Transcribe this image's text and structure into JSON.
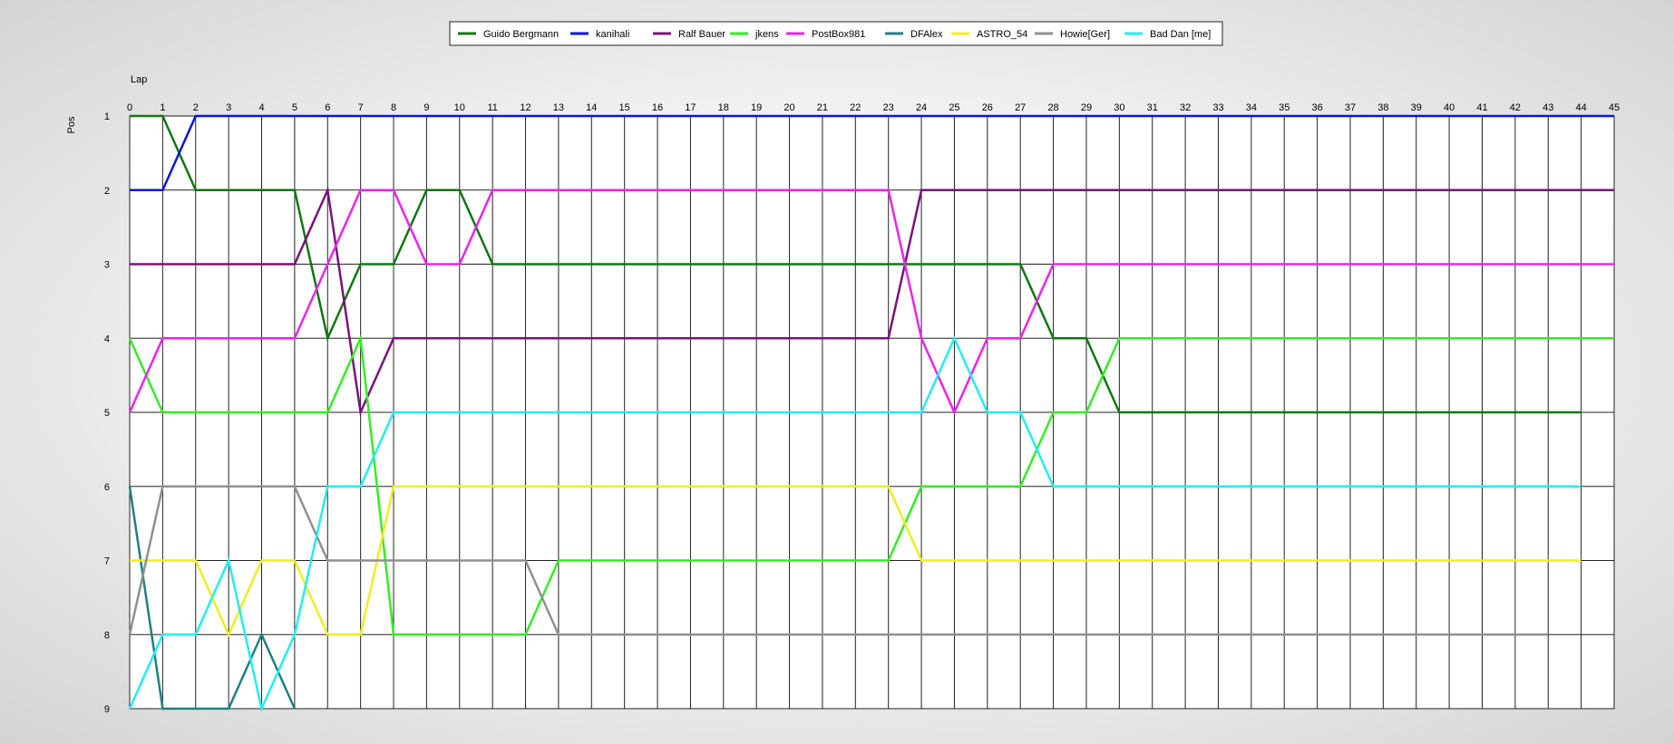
{
  "chart_data": {
    "type": "line",
    "xlabel": "Lap",
    "ylabel": "Pos",
    "xlim": [
      0,
      45
    ],
    "ylim": [
      1,
      9
    ],
    "y_inverted": true,
    "grid": true,
    "legend_position": "top-center",
    "x_ticks": [
      0,
      1,
      2,
      3,
      4,
      5,
      6,
      7,
      8,
      9,
      10,
      11,
      12,
      13,
      14,
      15,
      16,
      17,
      18,
      19,
      20,
      21,
      22,
      23,
      24,
      25,
      26,
      27,
      28,
      29,
      30,
      31,
      32,
      33,
      34,
      35,
      36,
      37,
      38,
      39,
      40,
      41,
      42,
      43,
      44,
      45
    ],
    "y_ticks": [
      1,
      2,
      3,
      4,
      5,
      6,
      7,
      8,
      9
    ],
    "series": [
      {
        "name": "Guido Bergmann",
        "color": "#117711",
        "x": [
          0,
          1,
          2,
          3,
          4,
          5,
          6,
          7,
          8,
          9,
          10,
          11,
          12,
          13,
          14,
          15,
          16,
          17,
          18,
          19,
          20,
          21,
          22,
          23,
          24,
          25,
          26,
          27,
          28,
          29,
          30,
          31,
          32,
          33,
          34,
          35,
          36,
          37,
          38,
          39,
          40,
          41,
          42,
          43,
          44
        ],
        "y": [
          1,
          1,
          2,
          2,
          2,
          2,
          4,
          3,
          3,
          2,
          2,
          3,
          3,
          3,
          3,
          3,
          3,
          3,
          3,
          3,
          3,
          3,
          3,
          3,
          3,
          3,
          3,
          3,
          4,
          4,
          5,
          5,
          5,
          5,
          5,
          5,
          5,
          5,
          5,
          5,
          5,
          5,
          5,
          5,
          5
        ]
      },
      {
        "name": "kanihali",
        "color": "#0a14e6",
        "x": [
          0,
          1,
          2,
          3,
          4,
          5,
          6,
          7,
          8,
          9,
          10,
          11,
          12,
          13,
          14,
          15,
          16,
          17,
          18,
          19,
          20,
          21,
          22,
          23,
          24,
          25,
          26,
          27,
          28,
          29,
          30,
          31,
          32,
          33,
          34,
          35,
          36,
          37,
          38,
          39,
          40,
          41,
          42,
          43,
          44,
          45
        ],
        "y": [
          2,
          2,
          1,
          1,
          1,
          1,
          1,
          1,
          1,
          1,
          1,
          1,
          1,
          1,
          1,
          1,
          1,
          1,
          1,
          1,
          1,
          1,
          1,
          1,
          1,
          1,
          1,
          1,
          1,
          1,
          1,
          1,
          1,
          1,
          1,
          1,
          1,
          1,
          1,
          1,
          1,
          1,
          1,
          1,
          1,
          1
        ]
      },
      {
        "name": "Ralf Bauer",
        "color": "#7a127a",
        "x": [
          0,
          1,
          2,
          3,
          4,
          5,
          6,
          7,
          8,
          9,
          10,
          11,
          12,
          13,
          14,
          15,
          16,
          17,
          18,
          19,
          20,
          21,
          22,
          23,
          24,
          25,
          26,
          27,
          28,
          29,
          30,
          31,
          32,
          33,
          34,
          35,
          36,
          37,
          38,
          39,
          40,
          41,
          42,
          43,
          44,
          45
        ],
        "y": [
          3,
          3,
          3,
          3,
          3,
          3,
          2,
          5,
          4,
          4,
          4,
          4,
          4,
          4,
          4,
          4,
          4,
          4,
          4,
          4,
          4,
          4,
          4,
          4,
          2,
          2,
          2,
          2,
          2,
          2,
          2,
          2,
          2,
          2,
          2,
          2,
          2,
          2,
          2,
          2,
          2,
          2,
          2,
          2,
          2,
          2
        ]
      },
      {
        "name": "jkens",
        "color": "#33ee22",
        "x": [
          0,
          1,
          2,
          3,
          4,
          5,
          6,
          7,
          8,
          9,
          10,
          11,
          12,
          13,
          14,
          15,
          16,
          17,
          18,
          19,
          20,
          21,
          22,
          23,
          24,
          25,
          26,
          27,
          28,
          29,
          30,
          31,
          32,
          33,
          34,
          35,
          36,
          37,
          38,
          39,
          40,
          41,
          42,
          43,
          44,
          45
        ],
        "y": [
          4,
          5,
          5,
          5,
          5,
          5,
          5,
          4,
          8,
          8,
          8,
          8,
          8,
          7,
          7,
          7,
          7,
          7,
          7,
          7,
          7,
          7,
          7,
          7,
          6,
          6,
          6,
          6,
          5,
          5,
          4,
          4,
          4,
          4,
          4,
          4,
          4,
          4,
          4,
          4,
          4,
          4,
          4,
          4,
          4,
          4
        ]
      },
      {
        "name": "PostBox981",
        "color": "#ee22ee",
        "x": [
          0,
          1,
          2,
          3,
          4,
          5,
          6,
          7,
          8,
          9,
          10,
          11,
          12,
          13,
          14,
          15,
          16,
          17,
          18,
          19,
          20,
          21,
          22,
          23,
          24,
          25,
          26,
          27,
          28,
          29,
          30,
          31,
          32,
          33,
          34,
          35,
          36,
          37,
          38,
          39,
          40,
          41,
          42,
          43,
          44,
          45
        ],
        "y": [
          5,
          4,
          4,
          4,
          4,
          4,
          3,
          2,
          2,
          3,
          3,
          2,
          2,
          2,
          2,
          2,
          2,
          2,
          2,
          2,
          2,
          2,
          2,
          2,
          4,
          5,
          4,
          4,
          3,
          3,
          3,
          3,
          3,
          3,
          3,
          3,
          3,
          3,
          3,
          3,
          3,
          3,
          3,
          3,
          3,
          3
        ]
      },
      {
        "name": "DFAlex",
        "color": "#1f8080",
        "x": [
          0,
          1,
          2,
          3,
          4,
          5
        ],
        "y": [
          6,
          9,
          9,
          9,
          8,
          9
        ]
      },
      {
        "name": "ASTRO_54",
        "color": "#eeee22",
        "x": [
          0,
          1,
          2,
          3,
          4,
          5,
          6,
          7,
          8,
          9,
          10,
          11,
          12,
          13,
          14,
          15,
          16,
          17,
          18,
          19,
          20,
          21,
          22,
          23,
          24,
          25,
          26,
          27,
          28,
          29,
          30,
          31,
          32,
          33,
          34,
          35,
          36,
          37,
          38,
          39,
          40,
          41,
          42,
          43,
          44
        ],
        "y": [
          7,
          7,
          7,
          8,
          7,
          7,
          8,
          8,
          6,
          6,
          6,
          6,
          6,
          6,
          6,
          6,
          6,
          6,
          6,
          6,
          6,
          6,
          6,
          6,
          7,
          7,
          7,
          7,
          7,
          7,
          7,
          7,
          7,
          7,
          7,
          7,
          7,
          7,
          7,
          7,
          7,
          7,
          7,
          7,
          7
        ]
      },
      {
        "name": "Howie[Ger]",
        "color": "#909090",
        "x": [
          0,
          1,
          2,
          3,
          4,
          5,
          6,
          7,
          8,
          9,
          10,
          11,
          12,
          13,
          14,
          15,
          16,
          17,
          18,
          19,
          20,
          21,
          22,
          23,
          24,
          25,
          26,
          27,
          28,
          29,
          30,
          31,
          32,
          33,
          34,
          35,
          36,
          37,
          38,
          39,
          40,
          41,
          42,
          43
        ],
        "y": [
          8,
          6,
          6,
          6,
          6,
          6,
          7,
          7,
          7,
          7,
          7,
          7,
          7,
          8,
          8,
          8,
          8,
          8,
          8,
          8,
          8,
          8,
          8,
          8,
          8,
          8,
          8,
          8,
          8,
          8,
          8,
          8,
          8,
          8,
          8,
          8,
          8,
          8,
          8,
          8,
          8,
          8,
          8,
          8
        ]
      },
      {
        "name": "Bad Dan [me]",
        "color": "#22eeee",
        "x": [
          0,
          1,
          2,
          3,
          4,
          5,
          6,
          7,
          8,
          9,
          10,
          11,
          12,
          13,
          14,
          15,
          16,
          17,
          18,
          19,
          20,
          21,
          22,
          23,
          24,
          25,
          26,
          27,
          28,
          29,
          30,
          31,
          32,
          33,
          34,
          35,
          36,
          37,
          38,
          39,
          40,
          41,
          42,
          43,
          44
        ],
        "y": [
          9,
          8,
          8,
          7,
          9,
          8,
          6,
          6,
          5,
          5,
          5,
          5,
          5,
          5,
          5,
          5,
          5,
          5,
          5,
          5,
          5,
          5,
          5,
          5,
          5,
          4,
          5,
          5,
          6,
          6,
          6,
          6,
          6,
          6,
          6,
          6,
          6,
          6,
          6,
          6,
          6,
          6,
          6,
          6,
          6
        ]
      }
    ]
  }
}
